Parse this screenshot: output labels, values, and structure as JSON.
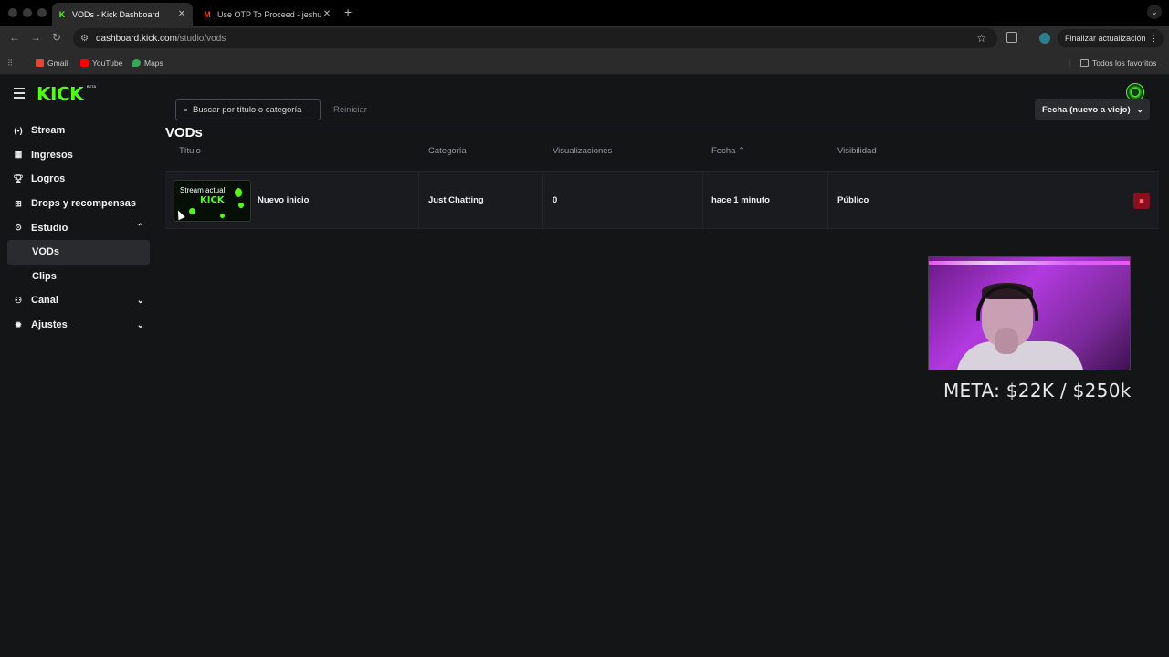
{
  "browser": {
    "tabs": [
      {
        "title": "VODs - Kick Dashboard",
        "favicon": "K",
        "active": true
      },
      {
        "title": "Use OTP To Proceed - jeshua",
        "favicon": "M",
        "active": false
      }
    ],
    "new_tab": "+",
    "url_host": "dashboard.kick.com",
    "url_path": "/studio/vods",
    "update_button": "Finalizar actualización",
    "bookmarks": [
      "Gmail",
      "YouTube",
      "Maps"
    ],
    "all_bookmarks": "Todos los favoritos",
    "colors": {
      "gmail": "#ea4335",
      "youtube": "#ff0000",
      "maps": "#34a853"
    }
  },
  "app": {
    "logo": "KICK",
    "logo_badge": "BETA",
    "brand_color": "#53fc18",
    "sidebar": {
      "items": [
        {
          "label": "Stream",
          "icon": "broadcast-icon"
        },
        {
          "label": "Ingresos",
          "icon": "chart-icon"
        },
        {
          "label": "Logros",
          "icon": "trophy-icon"
        },
        {
          "label": "Drops y recompensas",
          "icon": "gift-icon"
        },
        {
          "label": "Estudio",
          "icon": "studio-icon"
        },
        {
          "label": "Canal",
          "icon": "channel-icon"
        },
        {
          "label": "Ajustes",
          "icon": "gear-icon"
        }
      ],
      "studio_sub": [
        "VODs",
        "Clips"
      ]
    },
    "page_title": "VODs",
    "search_placeholder": "Buscar por título o categoría",
    "reset": "Reiniciar",
    "sort": "Fecha (nuevo a viejo)",
    "columns": [
      "Título",
      "Categoría",
      "Visualizaciones",
      "Fecha",
      "Visibilidad"
    ],
    "rows": [
      {
        "thumb_label": "Stream actual",
        "thumb_logo": "KICK",
        "title": "Nuevo inicio",
        "category": "Just Chatting",
        "views": "0",
        "date": "hace 1 minuto",
        "visibility": "Público"
      }
    ]
  },
  "overlay": {
    "meta": "META: $22K / $250k"
  }
}
